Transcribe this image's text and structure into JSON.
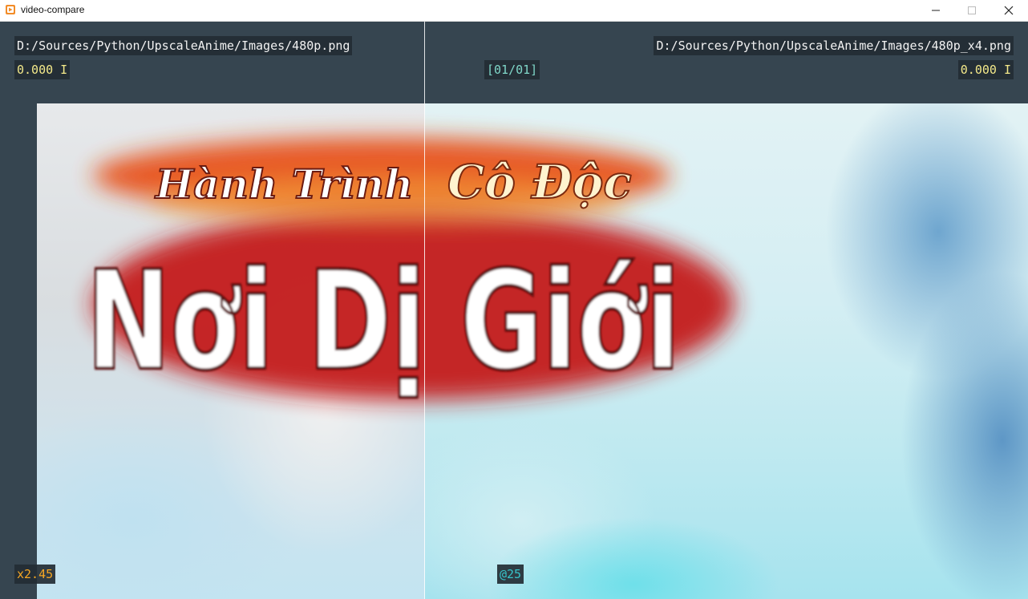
{
  "window": {
    "title": "video-compare",
    "controls": {
      "minimize": "—",
      "maximize": "☐",
      "close": "✕"
    }
  },
  "left": {
    "file_path": "D:/Sources/Python/UpscaleAnime/Images/480p.png",
    "time_info": "0.000 I"
  },
  "right": {
    "file_path": "D:/Sources/Python/UpscaleAnime/Images/480p_x4.png",
    "time_info": "0.000 I"
  },
  "frame_counter": "[01/01]",
  "zoom_label": "x2.45",
  "position_label": "@25",
  "image_text": {
    "line1_left": "Hành Trình",
    "line1_right": "Cô Độc",
    "line2": "Nơi Dị Giới"
  },
  "colors": {
    "background": "#364550",
    "overlay_bg": "#232c34",
    "path_text": "#f2f2f2",
    "time_text": "#f4e98a",
    "counter_text": "#7fd6c8",
    "zoom_text": "#f5a623",
    "position_text": "#37c3c9"
  }
}
